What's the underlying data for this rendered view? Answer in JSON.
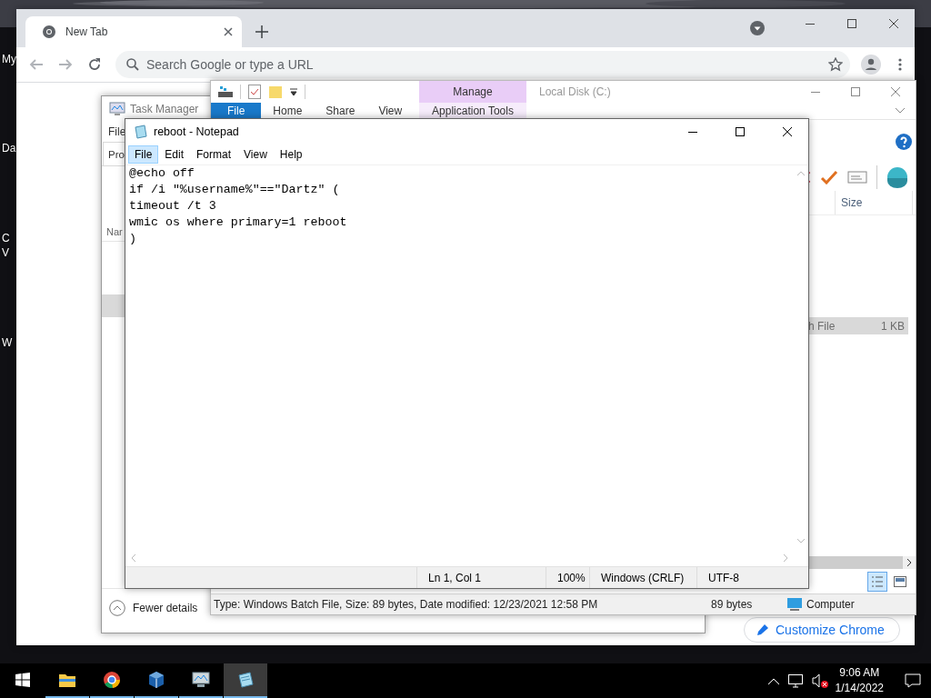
{
  "desktop": {
    "icon_labels": [
      "My",
      "Da",
      "C",
      "V",
      "W"
    ]
  },
  "browser": {
    "tabs": [
      {
        "title": "New Tab",
        "selected": true
      }
    ],
    "omnibox": {
      "placeholder": "Search Google or type a URL"
    },
    "customize_button": "Customize Chrome"
  },
  "task_manager": {
    "title": "Task Manager",
    "menu": [
      "File"
    ],
    "tabs": [
      {
        "label": "Pro",
        "selected": true
      }
    ],
    "column_1": "Nar",
    "fewer_details": "Fewer details"
  },
  "explorer": {
    "title": "Local Disk (C:)",
    "ribbon_tabs": [
      {
        "label": "File",
        "selected": true
      },
      {
        "label": "Home",
        "selected": false
      },
      {
        "label": "Share",
        "selected": false
      },
      {
        "label": "View",
        "selected": false
      }
    ],
    "contextual_group": "Manage",
    "contextual_tab": "Application Tools",
    "columns": [
      "Size"
    ],
    "rows": [
      {
        "column_1": "h File",
        "size": "1 KB",
        "selected": true
      }
    ],
    "status": {
      "details": "Type: Windows Batch File, Size: 89 bytes, Date modified: 12/23/2021 12:58 PM",
      "size": "89 bytes",
      "zone": "Computer"
    }
  },
  "notepad": {
    "title": "reboot - Notepad",
    "menu": [
      {
        "label": "File",
        "selected": true
      },
      {
        "label": "Edit",
        "selected": false
      },
      {
        "label": "Format",
        "selected": false
      },
      {
        "label": "View",
        "selected": false
      },
      {
        "label": "Help",
        "selected": false
      }
    ],
    "lines": [
      "@echo off",
      "if /i \"%username%\"==\"Dartz\" (",
      "timeout /t 3",
      "wmic os where primary=1 reboot",
      ")"
    ],
    "status": [
      "Ln 1, Col 1",
      "100%",
      "Windows (CRLF)",
      "UTF-8"
    ]
  },
  "taskbar": {
    "apps": [
      {
        "kind": "folder",
        "running": true,
        "active": false
      },
      {
        "kind": "browser",
        "running": true,
        "active": false
      },
      {
        "kind": "cube",
        "running": true,
        "active": false
      },
      {
        "kind": "monitor",
        "running": true,
        "active": false
      },
      {
        "kind": "notepad",
        "running": true,
        "active": true
      }
    ],
    "clock": {
      "time": "9:06 AM",
      "date": "1/14/2022"
    }
  }
}
